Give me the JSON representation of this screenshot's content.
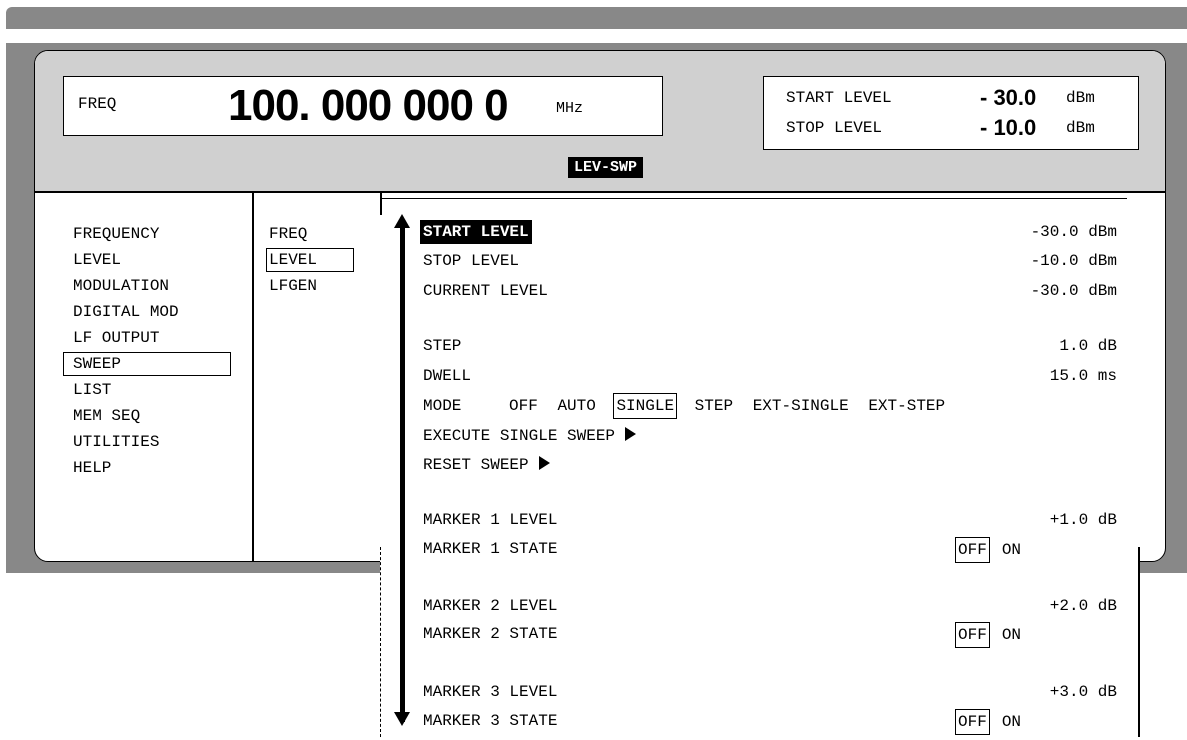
{
  "header": {
    "freq_label": "FREQ",
    "freq_value": "100. 000 000 0",
    "freq_unit": "MHz",
    "start_level_label": "START LEVEL",
    "start_level_value": "- 30.0",
    "start_level_unit": "dBm",
    "stop_level_label": "STOP LEVEL",
    "stop_level_value": "- 10.0",
    "stop_level_unit": "dBm",
    "mode_badge": "LEV-SWP"
  },
  "menu1": {
    "items": [
      "FREQUENCY",
      "LEVEL",
      "MODULATION",
      "DIGITAL MOD",
      "LF OUTPUT",
      "SWEEP",
      "LIST",
      "MEM SEQ",
      "UTILITIES",
      "HELP"
    ],
    "selected": "SWEEP"
  },
  "menu2": {
    "items": [
      "FREQ",
      "LEVEL",
      "LFGEN"
    ],
    "selected": "LEVEL"
  },
  "panel": {
    "start_level_label": "START LEVEL",
    "start_level_value": "-30.0 dBm",
    "stop_level_label": "STOP LEVEL",
    "stop_level_value": "-10.0 dBm",
    "current_level_label": "CURRENT LEVEL",
    "current_level_value": "-30.0 dBm",
    "step_label": "STEP",
    "step_value": "1.0 dB",
    "dwell_label": "DWELL",
    "dwell_value": "15.0 ms",
    "mode_label": "MODE",
    "mode_options": [
      "OFF",
      "AUTO",
      "SINGLE",
      "STEP",
      "EXT-SINGLE",
      "EXT-STEP"
    ],
    "mode_selected": "SINGLE",
    "execute_label": "EXECUTE SINGLE SWEEP",
    "reset_label": "RESET SWEEP",
    "marker1_level_label": "MARKER 1 LEVEL",
    "marker1_level_value": "+1.0 dB",
    "marker1_state_label": "MARKER 1 STATE",
    "marker2_level_label": "MARKER 2 LEVEL",
    "marker2_level_value": "+2.0 dB",
    "marker2_state_label": "MARKER 2 STATE",
    "marker3_level_label": "MARKER 3 LEVEL",
    "marker3_level_value": "+3.0 dB",
    "marker3_state_label": "MARKER 3 STATE",
    "state_off": "OFF",
    "state_on": "ON"
  }
}
